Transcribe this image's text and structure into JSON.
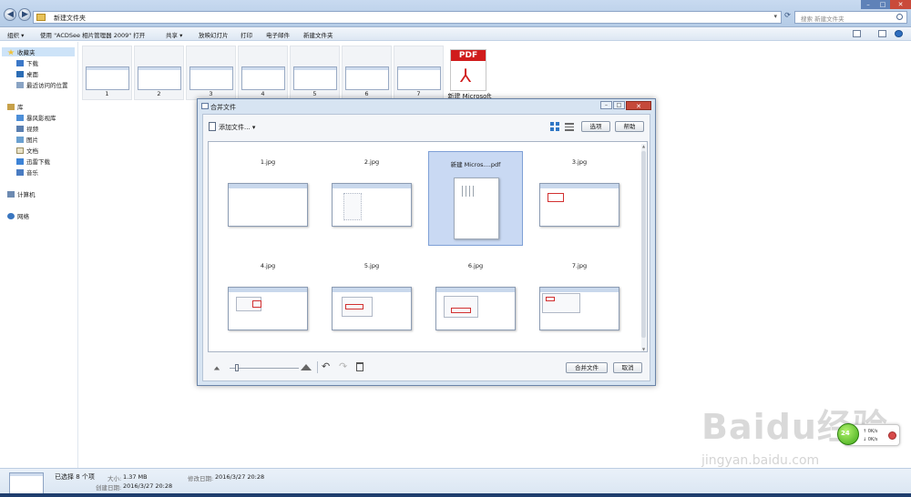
{
  "address_bar": {
    "path": "新建文件夹",
    "search_placeholder": "搜索 新建文件夹"
  },
  "toolbar": {
    "organize": "组织 ▾",
    "open_with": "使用 \"ACDSee 相片管理器 2009\" 打开",
    "share": "共享 ▾",
    "slideshow": "放映幻灯片",
    "print": "打印",
    "email": "电子邮件",
    "new_folder": "新建文件夹"
  },
  "sidebar": {
    "favorites": "收藏夹",
    "favorites_items": [
      "下载",
      "桌面",
      "最近访问的位置"
    ],
    "libraries": "库",
    "library_items": [
      "暴风影视库",
      "视频",
      "图片",
      "文档",
      "迅雷下载",
      "音乐"
    ],
    "computer": "计算机",
    "network": "网络"
  },
  "folder_items": [
    {
      "label": "1"
    },
    {
      "label": "2"
    },
    {
      "label": "3"
    },
    {
      "label": "4"
    },
    {
      "label": "5"
    },
    {
      "label": "6"
    },
    {
      "label": "7"
    }
  ],
  "pdf_item": {
    "badge": "PDF",
    "label": "新建 Microsoft"
  },
  "dialog": {
    "title": "合并文件",
    "add_files": "添加文件...",
    "options": "选项",
    "help": "帮助",
    "close": "✕",
    "tiles": [
      {
        "name": "1.jpg"
      },
      {
        "name": "2.jpg"
      },
      {
        "name": "新建 Micros....pdf",
        "selected": true
      },
      {
        "name": "3.jpg"
      },
      {
        "name": "4.jpg"
      },
      {
        "name": "5.jpg"
      },
      {
        "name": "6.jpg"
      },
      {
        "name": "7.jpg"
      }
    ],
    "combine": "合并文件",
    "cancel": "取消"
  },
  "status": {
    "selected": "已选择 8 个项",
    "size_label": "大小:",
    "size_value": "1.37 MB",
    "modified_label": "修改日期:",
    "modified_value": "2016/3/27 20:28",
    "created_label": "创建日期:",
    "created_value": "2016/3/27 20:28"
  },
  "net_widget": {
    "up": "0K/s",
    "down": "0K/s",
    "ball_text": "24"
  },
  "watermark": {
    "logo": "Baidu经验",
    "url": "jingyan.baidu.com"
  }
}
